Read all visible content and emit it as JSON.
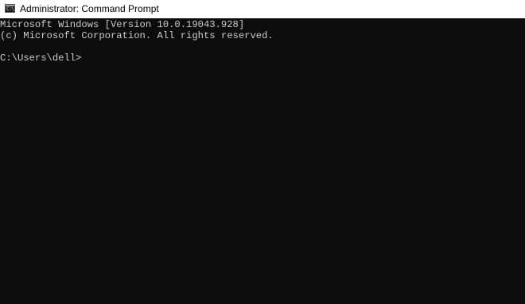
{
  "window": {
    "title": "Administrator: Command Prompt",
    "icon": "cmd-icon",
    "icon_text": "C:\\"
  },
  "console": {
    "lines": [
      "Microsoft Windows [Version 10.0.19043.928]",
      "(c) Microsoft Corporation. All rights reserved.",
      "",
      "C:\\Users\\dell>"
    ]
  },
  "colors": {
    "console_background": "#0c0c0c",
    "console_text": "#cccccc",
    "titlebar_background": "#ffffff"
  }
}
